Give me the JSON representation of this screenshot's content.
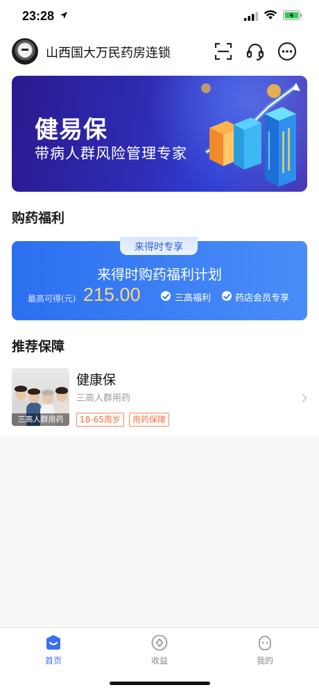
{
  "status_bar": {
    "time": "23:28"
  },
  "header": {
    "store_name": "山西国大万民药房连锁"
  },
  "banner": {
    "title": "健易保",
    "subtitle": "带病人群风险管理专家"
  },
  "benefit_section": {
    "title": "购药福利",
    "card": {
      "tag": "来得时专享",
      "title": "来得时购药福利计划",
      "max_label": "最高可得(元)",
      "max_amount": "215.00",
      "perks": [
        "三高福利",
        "药店会员专享"
      ]
    }
  },
  "recommend_section": {
    "title": "推荐保障",
    "products": [
      {
        "name": "健康保",
        "description": "三高人群用药",
        "image_caption": "三高人群用药",
        "badges": [
          "18-65周岁",
          "用药保障"
        ]
      }
    ]
  },
  "tabbar": {
    "items": [
      {
        "label": "首页",
        "active": true
      },
      {
        "label": "收益",
        "active": false
      },
      {
        "label": "我的",
        "active": false
      }
    ]
  },
  "colors": {
    "accent": "#3b6ef0",
    "amount": "#ffd97a",
    "badge": "#f0703a"
  }
}
